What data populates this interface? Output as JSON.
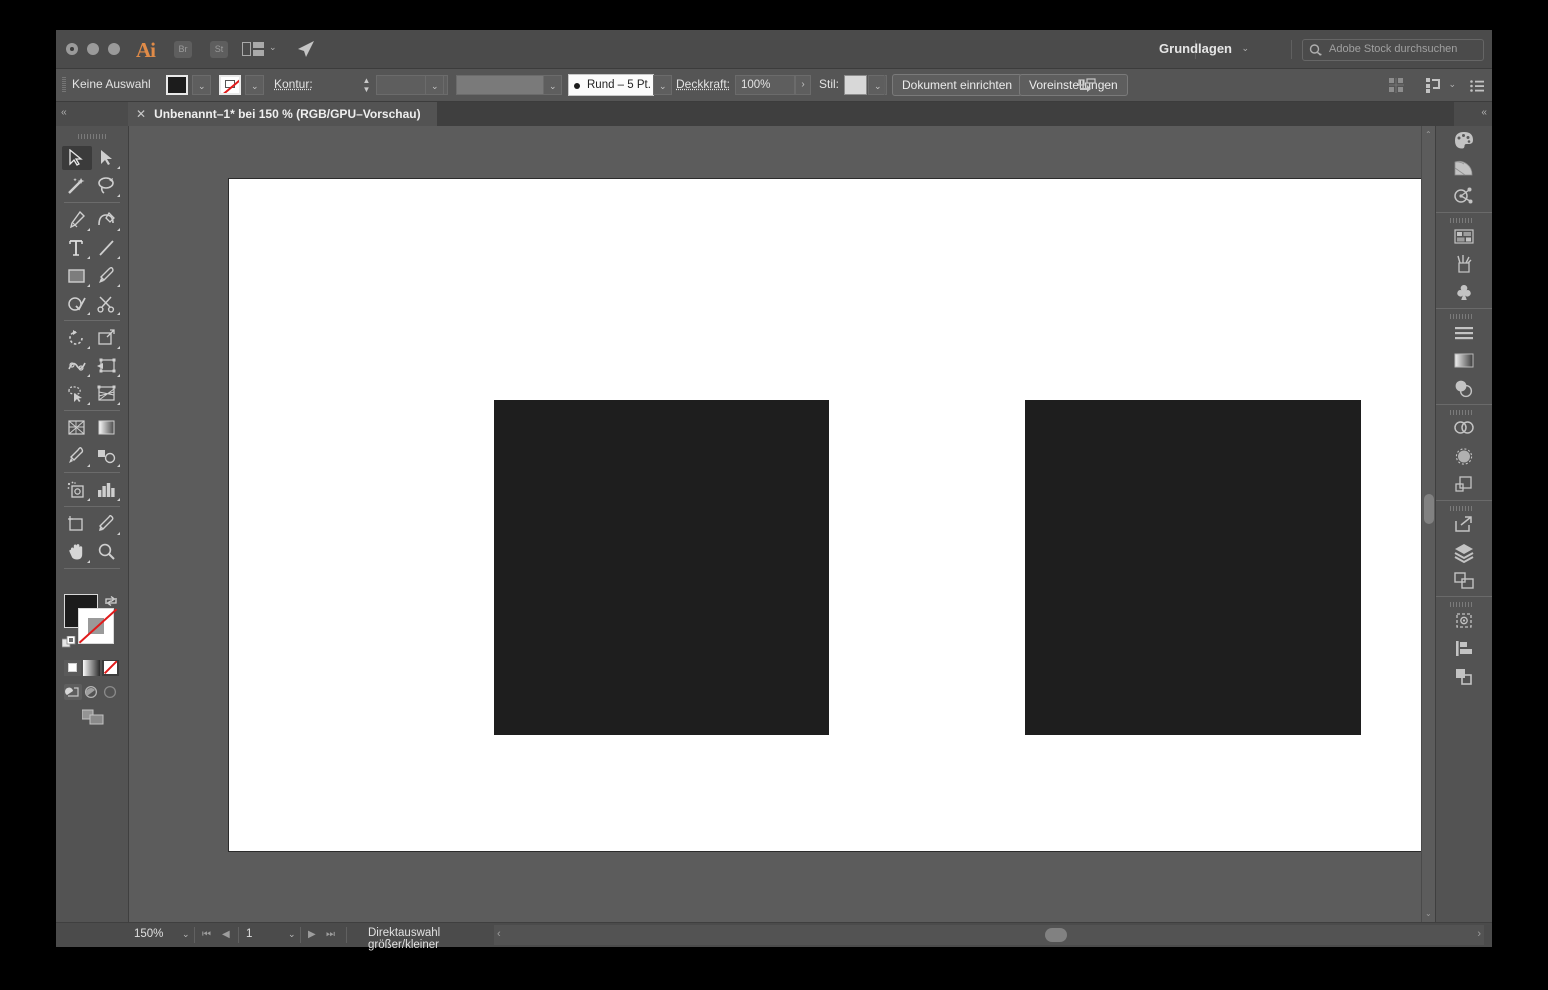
{
  "titlebar": {
    "app_name": "Ai",
    "bridge_label": "Br",
    "stock_label": "St",
    "workspace": "Grundlagen",
    "search_placeholder": "Adobe Stock durchsuchen",
    "accent_color": "#e08b48"
  },
  "controlbar": {
    "selection_status": "Keine Auswahl",
    "fill_color": "#1c1c1c",
    "stroke_label": "Kontur:",
    "stroke_weight": "",
    "stroke_profile": "",
    "brush_label": "Rund – 5 Pt.",
    "opacity_label": "Deckkraft:",
    "opacity_value": "100%",
    "style_label": "Stil:",
    "document_setup_label": "Dokument einrichten",
    "preferences_label": "Voreinstellungen"
  },
  "tab": {
    "title": "Unbenannt–1* bei 150 % (RGB/GPU–Vorschau)",
    "close_label": "✕"
  },
  "toolbar": {
    "tools": [
      {
        "name": "selection-tool",
        "selected": true
      },
      {
        "name": "direct-selection-tool",
        "selected": false
      },
      {
        "name": "magic-wand-tool",
        "selected": false
      },
      {
        "name": "lasso-tool",
        "selected": false
      },
      {
        "name": "pen-tool",
        "selected": false
      },
      {
        "name": "curvature-tool",
        "selected": false
      },
      {
        "name": "type-tool",
        "selected": false
      },
      {
        "name": "line-segment-tool",
        "selected": false
      },
      {
        "name": "rectangle-tool",
        "selected": false
      },
      {
        "name": "paintbrush-tool",
        "selected": false
      },
      {
        "name": "shaper-tool",
        "selected": false
      },
      {
        "name": "scissors-tool",
        "selected": false
      },
      {
        "name": "rotate-tool",
        "selected": false
      },
      {
        "name": "scale-tool",
        "selected": false
      },
      {
        "name": "width-tool",
        "selected": false
      },
      {
        "name": "free-transform-tool",
        "selected": false
      },
      {
        "name": "shape-builder-tool",
        "selected": false
      },
      {
        "name": "perspective-grid-tool",
        "selected": false
      },
      {
        "name": "mesh-tool",
        "selected": false
      },
      {
        "name": "gradient-tool",
        "selected": false
      },
      {
        "name": "eyedropper-tool",
        "selected": false
      },
      {
        "name": "blend-tool",
        "selected": false
      },
      {
        "name": "symbol-sprayer-tool",
        "selected": false
      },
      {
        "name": "column-graph-tool",
        "selected": false
      },
      {
        "name": "artboard-tool",
        "selected": false
      },
      {
        "name": "slice-tool",
        "selected": false
      },
      {
        "name": "hand-tool",
        "selected": false
      },
      {
        "name": "zoom-tool",
        "selected": false
      }
    ],
    "fill_color": "#1c1c1c",
    "stroke_color": "#ffffff",
    "stroke_is_none": true
  },
  "canvas": {
    "artboard_background": "#ffffff",
    "shapes": [
      {
        "name": "rectangle-left",
        "fill": "#1e1e1e"
      },
      {
        "name": "rectangle-right",
        "fill": "#1e1e1e"
      }
    ]
  },
  "rightdock": {
    "icons": [
      "color-panel-icon",
      "color-guide-icon",
      "color-themes-icon",
      "swatches-icon",
      "brushes-icon",
      "symbols-icon",
      "stroke-panel-icon",
      "gradient-icon",
      "transparency-icon",
      "pathfinder-icon",
      "transform-icon",
      "align-icon",
      "export-icon",
      "layers-icon",
      "artboards-icon",
      "asset-export-icon",
      "links-icon",
      "appearance-icon"
    ]
  },
  "statusbar": {
    "zoom_value": "150%",
    "page_value": "1",
    "tool_status": "Direktauswahl größer/kleiner"
  }
}
